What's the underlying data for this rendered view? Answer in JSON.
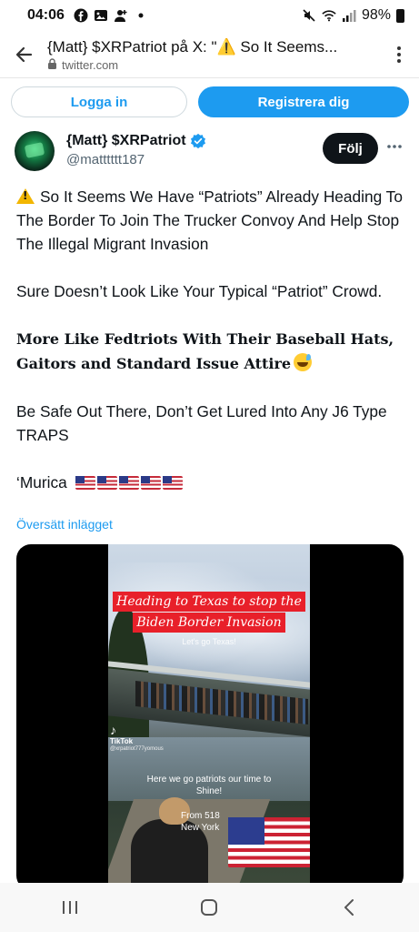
{
  "status_bar": {
    "time": "04:06",
    "left_icons": [
      "facebook-icon",
      "image-icon",
      "person-icon",
      "dot-icon"
    ],
    "battery": "98%",
    "right_icons": [
      "mute-icon",
      "wifi-icon",
      "signal-icon",
      "battery-icon"
    ]
  },
  "browser": {
    "page_title": "{Matt} $XRPatriot på X: \"⚠️ So It Seems...",
    "domain": "twitter.com"
  },
  "auth": {
    "login_label": "Logga in",
    "register_label": "Registrera dig"
  },
  "author": {
    "display_name": "{Matt} $XRPatriot",
    "handle": "@matttttt187",
    "follow_label": "Följ",
    "more_label": "···"
  },
  "tweet": {
    "p1": "So It Seems We Have “Patriots” Already Heading To The Border To Join The Trucker Convoy And Help Stop The Illegal Migrant Invasion",
    "p2": "Sure Doesn’t Look Like Your Typical “Patriot” Crowd.",
    "p3": "More Like Fedtriots With Their Baseball Hats, Gaitors and Standard Issue Attire",
    "p4": "Be Safe Out There, Don’t Get Lured Into Any J6 Type TRAPS",
    "p5": "‘Murica",
    "translate_label": "Översätt inlägget"
  },
  "video": {
    "caption_line1": "Heading to Texas to stop the",
    "caption_line2": "Biden Border Invasion",
    "small_caption": "Let's go Texas!",
    "tiktok_label": "TikTok",
    "tiktok_user": "@xrpatriot777yomous",
    "overlay_line1": "Here we go patriots our time to",
    "overlay_line2": "Shine!",
    "from_line1": "From 518",
    "from_line2": "New York"
  },
  "nav": {
    "icons": [
      "recents-icon",
      "home-icon",
      "back-icon"
    ]
  },
  "colors": {
    "accent": "#1d9bf0",
    "text": "#0f1419",
    "muted": "#536471",
    "caption_red": "#e8202a"
  }
}
